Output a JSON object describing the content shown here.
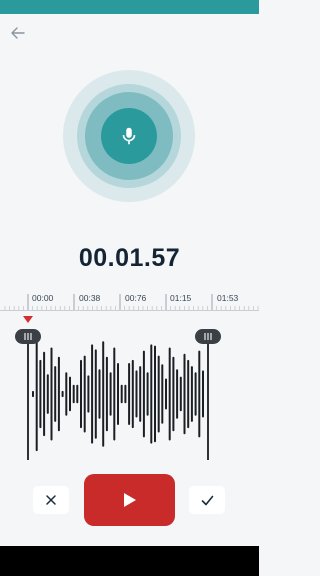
{
  "header": {
    "back_icon": "arrow-left-icon"
  },
  "recorder": {
    "mic_icon": "microphone-icon",
    "timer": "00.01.57"
  },
  "timeline": {
    "ticks": [
      "00:00",
      "00:38",
      "00:76",
      "01:15",
      "01:53"
    ]
  },
  "waveform": {
    "bar_levels": [
      0.05,
      0.92,
      0.55,
      0.68,
      0.32,
      0.75,
      0.45,
      0.6,
      0.05,
      0.35,
      0.28,
      0.15,
      0.15,
      0.55,
      0.62,
      0.3,
      0.8,
      0.72,
      0.4,
      0.85,
      0.6,
      0.35,
      0.75,
      0.5,
      0.15,
      0.15,
      0.5,
      0.55,
      0.38,
      0.45,
      0.7,
      0.35,
      0.8,
      0.78,
      0.62,
      0.48,
      0.25,
      0.75,
      0.6,
      0.4,
      0.28,
      0.65,
      0.55,
      0.45,
      0.35,
      0.7,
      0.38
    ]
  },
  "controls": {
    "cancel_icon": "close-icon",
    "play_icon": "play-icon",
    "confirm_icon": "check-icon"
  },
  "colors": {
    "accent": "#2a9a9c",
    "play": "#c92a2a",
    "playhead": "#d32f2f",
    "bars": "#1b1f24"
  }
}
